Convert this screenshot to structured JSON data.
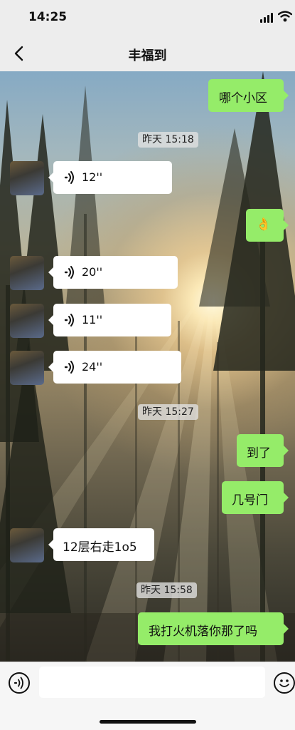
{
  "status_bar": {
    "time": "14:25"
  },
  "header": {
    "title": "丰福到"
  },
  "messages": {
    "m1": {
      "text": "哪个小区"
    },
    "t1": {
      "label": "昨天 15:18"
    },
    "v1": {
      "duration": "12''"
    },
    "m2": {
      "text": "👌"
    },
    "v2": {
      "duration": "20''"
    },
    "v3": {
      "duration": "11''"
    },
    "v4": {
      "duration": "24''"
    },
    "t2": {
      "label": "昨天 15:27"
    },
    "m3": {
      "text": "到了"
    },
    "m4": {
      "text": "几号门"
    },
    "m5": {
      "text": "12层右走1o5"
    },
    "t3": {
      "label": "昨天 15:58"
    },
    "m6": {
      "text": "我打火机落你那了吗"
    }
  },
  "input": {
    "value": ""
  },
  "colors": {
    "outgoing_bubble": "#95ec69",
    "incoming_bubble": "#ffffff",
    "bar_background": "#ededed"
  },
  "icons": {
    "back": "back-arrow-icon",
    "voice_message": "voice-wave-icon",
    "voice_input": "voice-input-icon",
    "emoji": "emoji-icon"
  }
}
